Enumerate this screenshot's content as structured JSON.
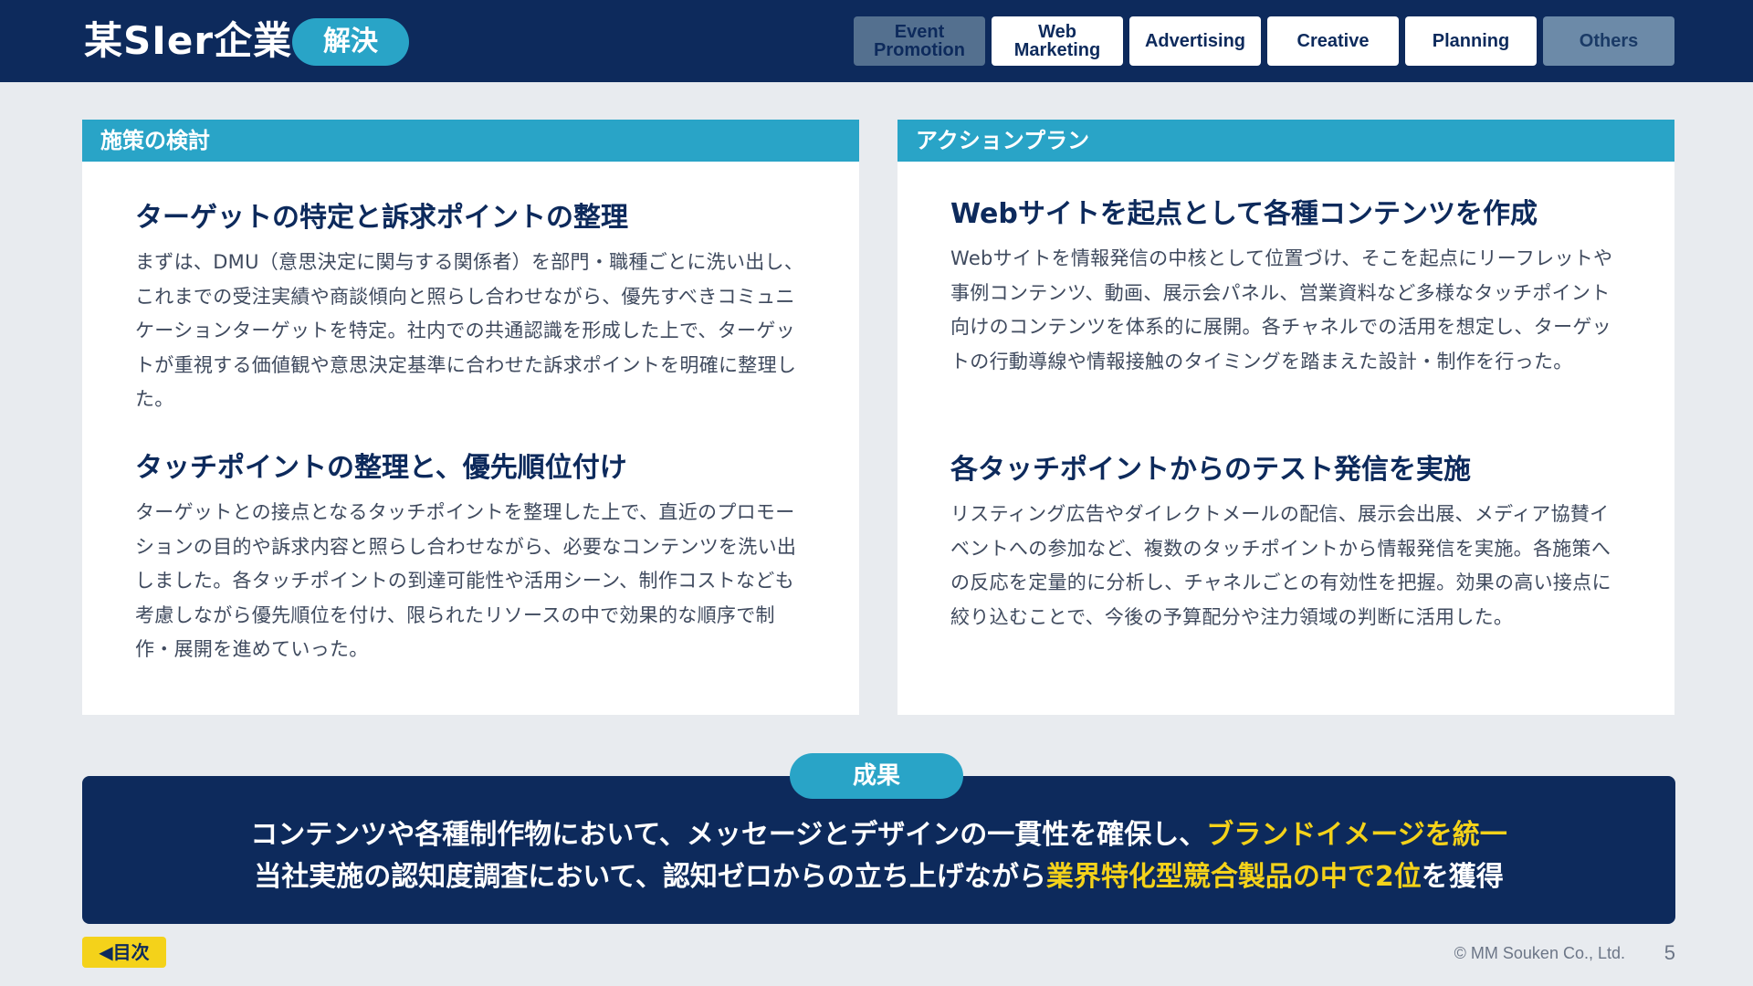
{
  "header": {
    "brand": "某SIer企業",
    "status": "解決",
    "nav": [
      {
        "label": "Event\nPromotion",
        "state": "inactive"
      },
      {
        "label": "Web\nMarketing",
        "state": "active"
      },
      {
        "label": "Advertising",
        "state": "active"
      },
      {
        "label": "Creative",
        "state": "active"
      },
      {
        "label": "Planning",
        "state": "active"
      },
      {
        "label": "Others",
        "state": "inactive"
      }
    ]
  },
  "left_panel": {
    "heading": "施策の検討",
    "sections": [
      {
        "title": "ターゲットの特定と訴求ポイントの整理",
        "body": "まずは、DMU（意思決定に関与する関係者）を部門・職種ごとに洗い出し、これまでの受注実績や商談傾向と照らし合わせながら、優先すべきコミュニケーションターゲットを特定。社内での共通認識を形成した上で、ターゲットが重視する価値観や意思決定基準に合わせた訴求ポイントを明確に整理した。"
      },
      {
        "title": "タッチポイントの整理と、優先順位付け",
        "body": "ターゲットとの接点となるタッチポイントを整理した上で、直近のプロモーションの目的や訴求内容と照らし合わせながら、必要なコンテンツを洗い出しました。各タッチポイントの到達可能性や活用シーン、制作コストなども考慮しながら優先順位を付け、限られたリソースの中で効果的な順序で制作・展開を進めていった。"
      }
    ]
  },
  "right_panel": {
    "heading": "アクションプラン",
    "sections": [
      {
        "title": "Webサイトを起点として各種コンテンツを作成",
        "body": "Webサイトを情報発信の中核として位置づけ、そこを起点にリーフレットや事例コンテンツ、動画、展示会パネル、営業資料など多様なタッチポイント向けのコンテンツを体系的に展開。各チャネルでの活用を想定し、ターゲットの行動導線や情報接触のタイミングを踏まえた設計・制作を行った。"
      },
      {
        "title": "各タッチポイントからのテスト発信を実施",
        "body": "リスティング広告やダイレクトメールの配信、展示会出展、メディア協賛イベントへの参加など、複数のタッチポイントから情報発信を実施。各施策への反応を定量的に分析し、チャネルごとの有効性を把握。効果の高い接点に絞り込むことで、今後の予算配分や注力領域の判断に活用した。"
      }
    ]
  },
  "result": {
    "label": "成果",
    "line1_normal": "コンテンツや各種制作物において、メッセージとデザインの一貫性を確保し、",
    "line1_highlight": "ブランドイメージを統一",
    "line2_normal": "当社実施の認知度調査において、認知ゼロからの立ち上げながら",
    "line2_highlight": "業界特化型競合製品の中で2位",
    "line2_suffix": "を獲得"
  },
  "footer": {
    "back_label": "◀目次",
    "copyright": "© MM Souken Co., Ltd.",
    "page_number": "5"
  },
  "colors": {
    "navy": "#0d2a5c",
    "accent": "#29a4c7",
    "highlight": "#f4d21a",
    "background": "#e8ebef"
  }
}
